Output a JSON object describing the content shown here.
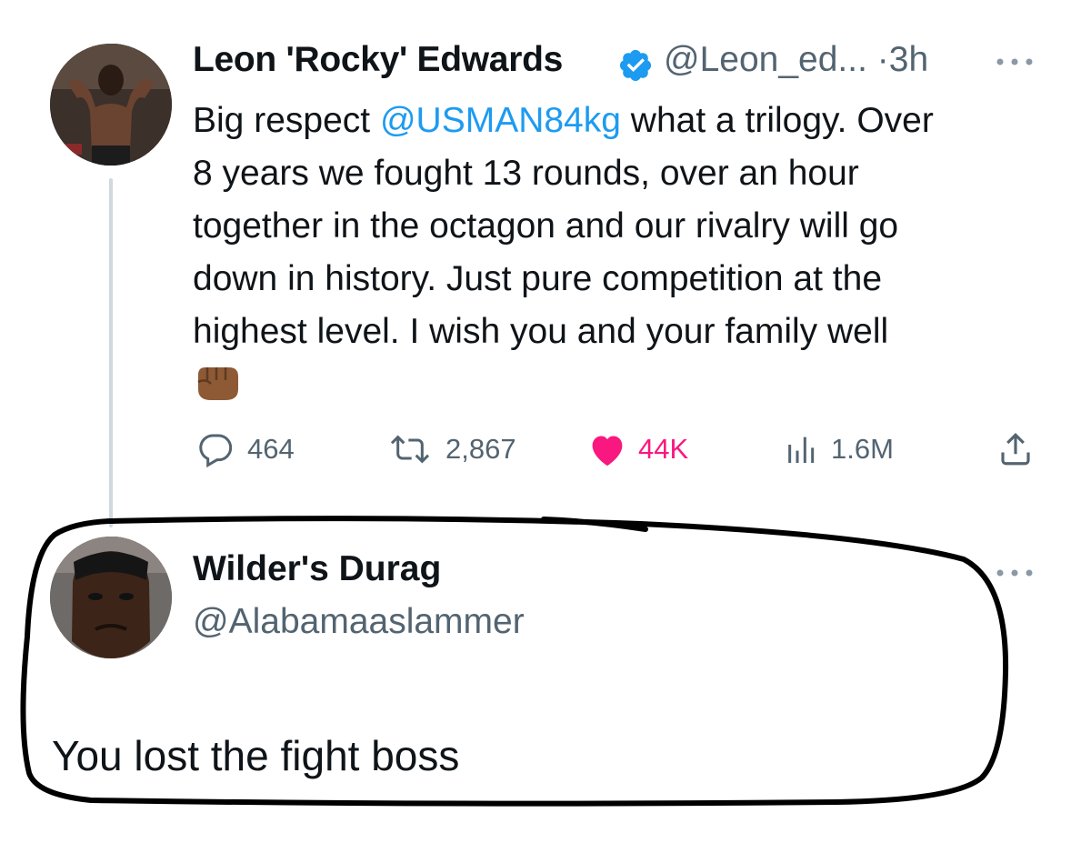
{
  "tweet": {
    "author_name": "Leon 'Rocky' Edwards",
    "handle": "@Leon_ed...",
    "separator": "·",
    "time": "3h",
    "text_before_mention": "Big respect ",
    "mention": "@USMAN84kg",
    "text_line1_rest": " what a trilogy. Over",
    "text_lines": [
      "8 years we fought 13 rounds, over an hour",
      "together in the octagon and our rivalry will go",
      "down in history. Just pure competition at the",
      "highest level. I wish you and your family well"
    ],
    "emoji": "oncoming-fist-dark-skin-tone",
    "verified": true,
    "stats": {
      "replies": "464",
      "retweets": "2,867",
      "likes": "44K",
      "views": "1.6M"
    },
    "like_color": "#f91880",
    "link_color": "#1d9bf0"
  },
  "reply": {
    "author_name": "Wilder's Durag",
    "handle": "@Alabamaaslammer",
    "text": "You lost the fight boss"
  },
  "icons": [
    "more-icon",
    "verified-badge-icon",
    "reply-icon",
    "retweet-icon",
    "like-icon",
    "views-icon",
    "share-icon"
  ],
  "annotation": {
    "type": "hand-drawn-outline",
    "color": "#000000"
  }
}
